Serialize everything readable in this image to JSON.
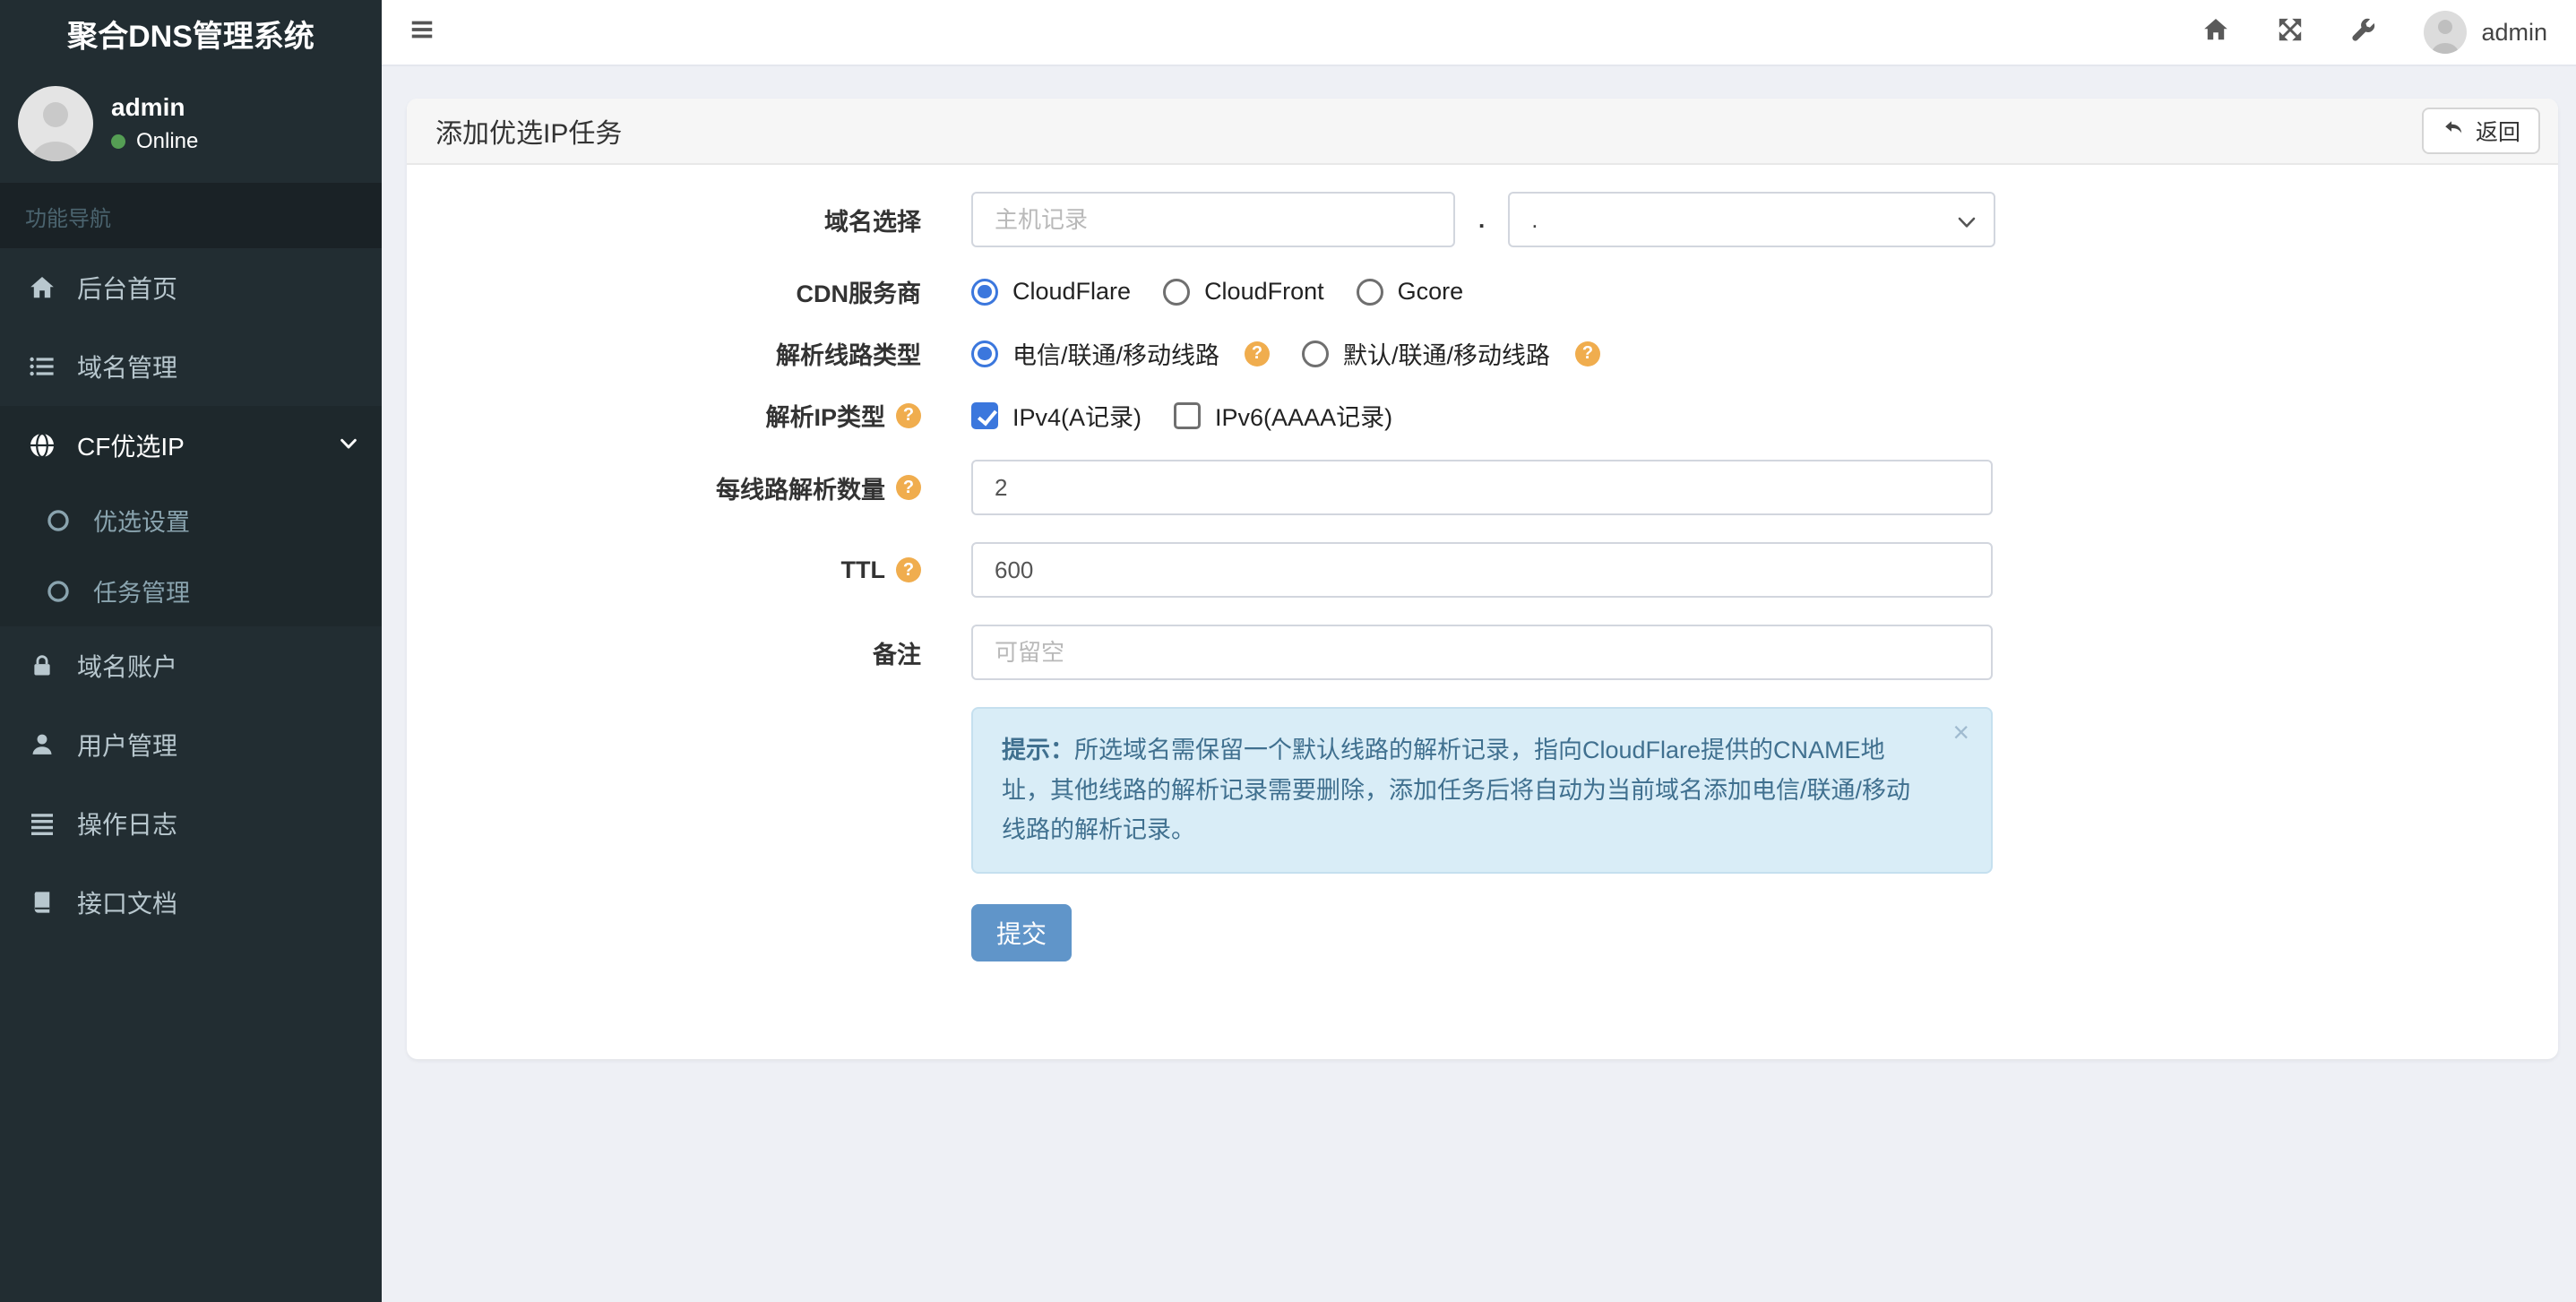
{
  "app": {
    "title": "聚合DNS管理系统"
  },
  "topbar": {
    "user_label": "admin"
  },
  "sidebar": {
    "user": {
      "name": "admin",
      "status": "Online"
    },
    "nav_header": "功能导航",
    "items": [
      {
        "label": "后台首页",
        "icon": "home-icon"
      },
      {
        "label": "域名管理",
        "icon": "list-icon"
      },
      {
        "label": "CF优选IP",
        "icon": "globe-icon",
        "expanded": true,
        "children": [
          {
            "label": "优选设置"
          },
          {
            "label": "任务管理"
          }
        ]
      },
      {
        "label": "域名账户",
        "icon": "lock-icon"
      },
      {
        "label": "用户管理",
        "icon": "user-icon"
      },
      {
        "label": "操作日志",
        "icon": "log-icon"
      },
      {
        "label": "接口文档",
        "icon": "book-icon"
      }
    ]
  },
  "page": {
    "card_title": "添加优选IP任务",
    "back_label": "返回",
    "form": {
      "domain": {
        "label": "域名选择",
        "host_placeholder": "主机记录",
        "separator": ".",
        "selected_domain": "."
      },
      "cdn": {
        "label": "CDN服务商",
        "selected": "CloudFlare",
        "options": [
          "CloudFlare",
          "CloudFront",
          "Gcore"
        ]
      },
      "line_type": {
        "label": "解析线路类型",
        "selected": "电信/联通/移动线路",
        "options": [
          {
            "label": "电信/联通/移动线路"
          },
          {
            "label": "默认/联通/移动线路"
          }
        ]
      },
      "ip_type": {
        "label": "解析IP类型",
        "options": [
          {
            "label": "IPv4(A记录)",
            "checked": true
          },
          {
            "label": "IPv6(AAAA记录)",
            "checked": false
          }
        ]
      },
      "per_line": {
        "label": "每线路解析数量",
        "value": "2"
      },
      "ttl": {
        "label": "TTL",
        "value": "600"
      },
      "remark": {
        "label": "备注",
        "placeholder": "可留空"
      },
      "hint": {
        "prefix": "提示：",
        "text": "所选域名需保留一个默认线路的解析记录，指向CloudFlare提供的CNAME地址，其他线路的解析记录需要删除，添加任务后将自动为当前域名添加电信/联通/移动线路的解析记录。",
        "close": "×"
      },
      "submit_label": "提交"
    }
  },
  "colors": {
    "sidebar_bg": "#222d32",
    "sidebar_dark": "#1e282c",
    "navheader_bg": "#1a2226",
    "navheader_fg": "#4b646f",
    "item_fg": "#b8c7ce",
    "subitem_fg": "#8aa4af",
    "page_bg": "#eef0f5",
    "card_header_bg": "#f6f6f6",
    "border": "#d2d6de",
    "accent": "#3b77dd",
    "help": "#f0ad4e",
    "hint_bg": "#d9edf7",
    "hint_border": "#c5e0ef",
    "hint_fg": "#40708f",
    "submit_bg": "#6095c9",
    "online_green": "#559e54"
  }
}
